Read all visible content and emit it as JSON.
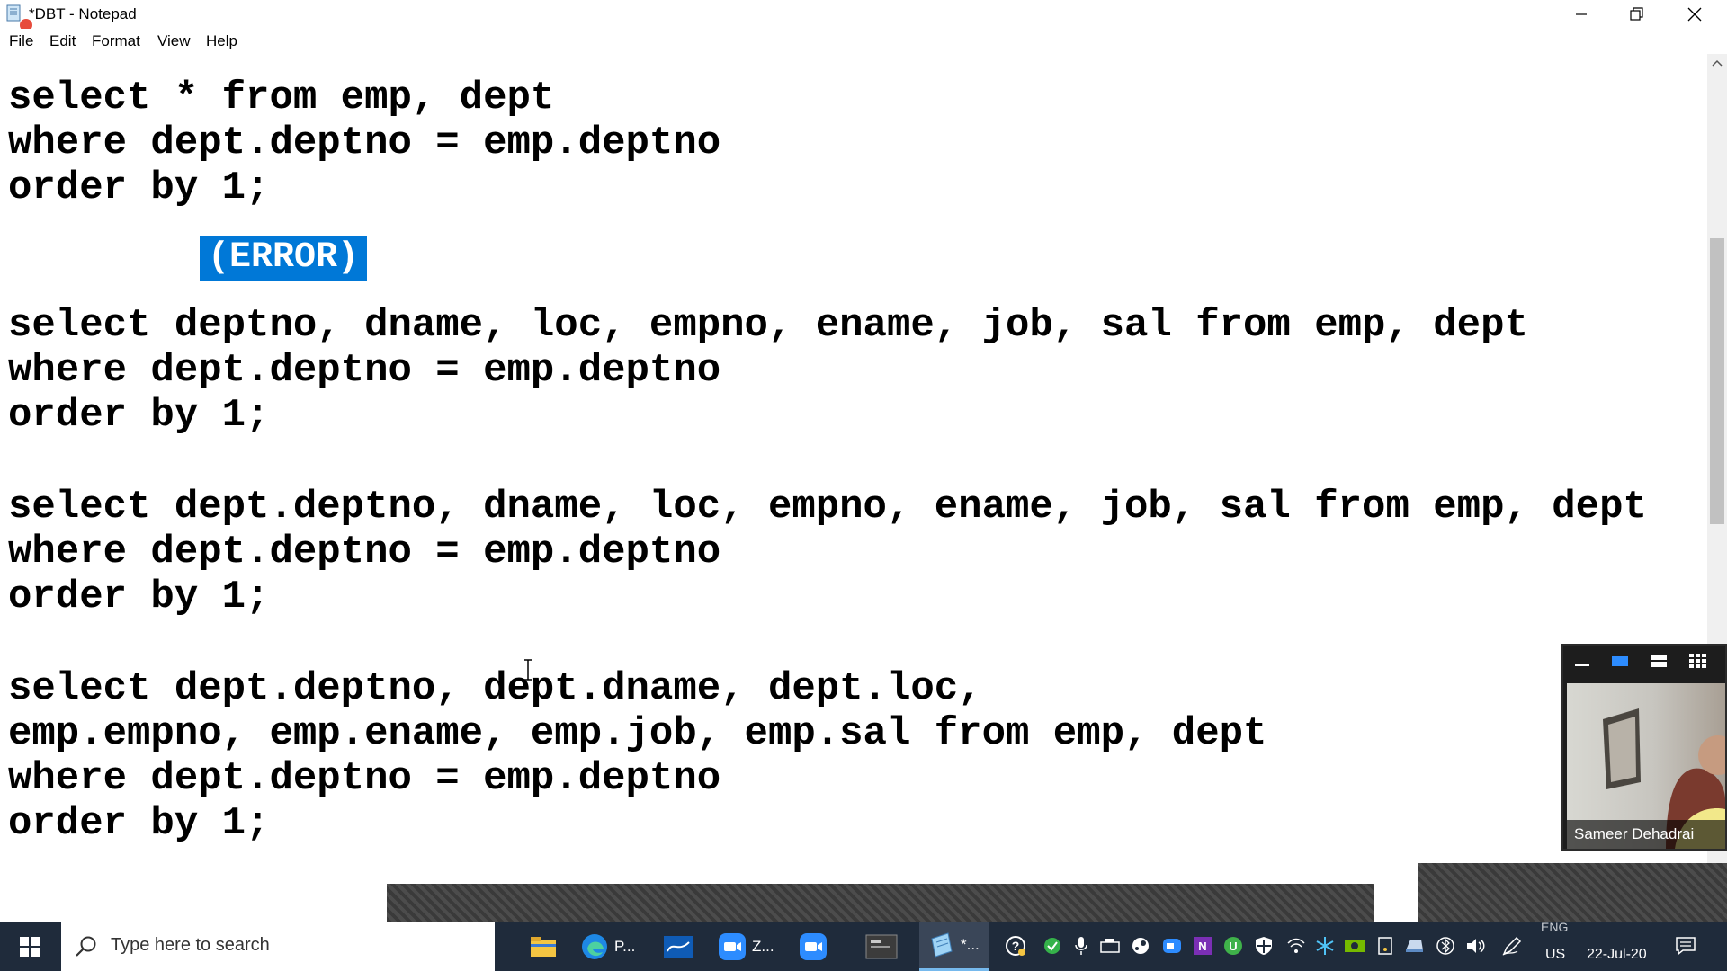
{
  "window": {
    "title": "*DBT - Notepad"
  },
  "menu": [
    "File",
    "Edit",
    "Format",
    "View",
    "Help"
  ],
  "editor": {
    "lines": [
      "select * from emp, dept",
      "where dept.deptno = emp.deptno",
      "order by 1;",
      "select deptno, dname, loc, empno, ename, job, sal from emp, dept",
      "where dept.deptno = emp.deptno",
      "order by 1;",
      "select dept.deptno, dname, loc, empno, ename, job, sal from emp, dept",
      "where dept.deptno = emp.deptno",
      "order by 1;",
      "select dept.deptno, dept.dname, dept.loc,",
      "emp.empno, emp.ename, emp.job, emp.sal from emp, dept",
      "where dept.deptno = emp.deptno",
      "order by 1;"
    ],
    "error_label": "(ERROR)"
  },
  "video": {
    "participant_name": "Sameer Dehadrai"
  },
  "taskbar": {
    "search_placeholder": "Type here to search",
    "apps": [
      {
        "icon": "file-explorer-icon"
      },
      {
        "icon": "edge-icon",
        "label": "P..."
      },
      {
        "icon": "whiteboard-icon"
      },
      {
        "icon": "zoom-icon",
        "label": "Z..."
      },
      {
        "icon": "zoom-meeting-icon"
      },
      {
        "icon": "sqlplus-icon"
      },
      {
        "icon": "notepad-icon",
        "label": "*..."
      }
    ],
    "tray": {
      "lang_top": "ENG",
      "lang_bottom": "US",
      "date": "22-Jul-20"
    },
    "colors": {
      "accent": "#0078d7",
      "taskbar_bg": "#1f2b3b"
    }
  }
}
